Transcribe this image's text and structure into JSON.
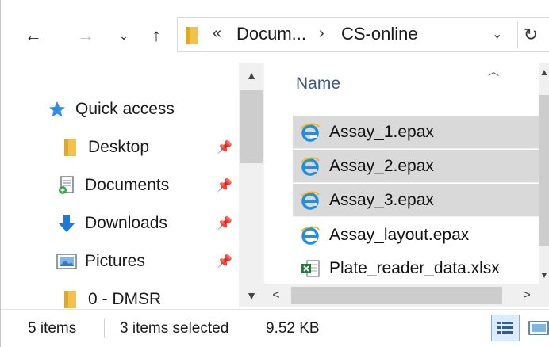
{
  "address": {
    "overflow_chevron": "«",
    "crumb_parent": "Docum...",
    "separator": "›",
    "crumb_current": "CS-online"
  },
  "nav_icons": {
    "back": "←",
    "forward": "→",
    "recent": "⌄",
    "up": "↑",
    "dropdown": "⌄",
    "refresh": "↻"
  },
  "navigation_pane": {
    "items": [
      {
        "label": "Quick access",
        "icon": "star-icon",
        "pinned": false
      },
      {
        "label": "Desktop",
        "icon": "folder-icon",
        "pinned": true
      },
      {
        "label": "Documents",
        "icon": "documents-icon",
        "pinned": true
      },
      {
        "label": "Downloads",
        "icon": "download-arrow-icon",
        "pinned": true
      },
      {
        "label": "Pictures",
        "icon": "pictures-icon",
        "pinned": true
      },
      {
        "label": "0 - DMSR",
        "icon": "folder-icon",
        "pinned": false
      }
    ]
  },
  "content": {
    "column_name": "Name",
    "files": [
      {
        "name": "Assay_1.epax",
        "icon": "ie-file-icon",
        "selected": true
      },
      {
        "name": "Assay_2.epax",
        "icon": "ie-file-icon",
        "selected": true
      },
      {
        "name": "Assay_3.epax",
        "icon": "ie-file-icon",
        "selected": true
      },
      {
        "name": "Assay_layout.epax",
        "icon": "ie-file-icon",
        "selected": false
      },
      {
        "name": "Plate_reader_data.xlsx",
        "icon": "excel-file-icon",
        "selected": false
      }
    ]
  },
  "status": {
    "item_count": "5 items",
    "selection": "3 items selected",
    "size": "9.52 KB"
  },
  "colors": {
    "selection": "#d9d9d9",
    "header_text": "#3c5a8a",
    "folder": "#f2c14e",
    "accent_blue": "#1e7ad6"
  }
}
